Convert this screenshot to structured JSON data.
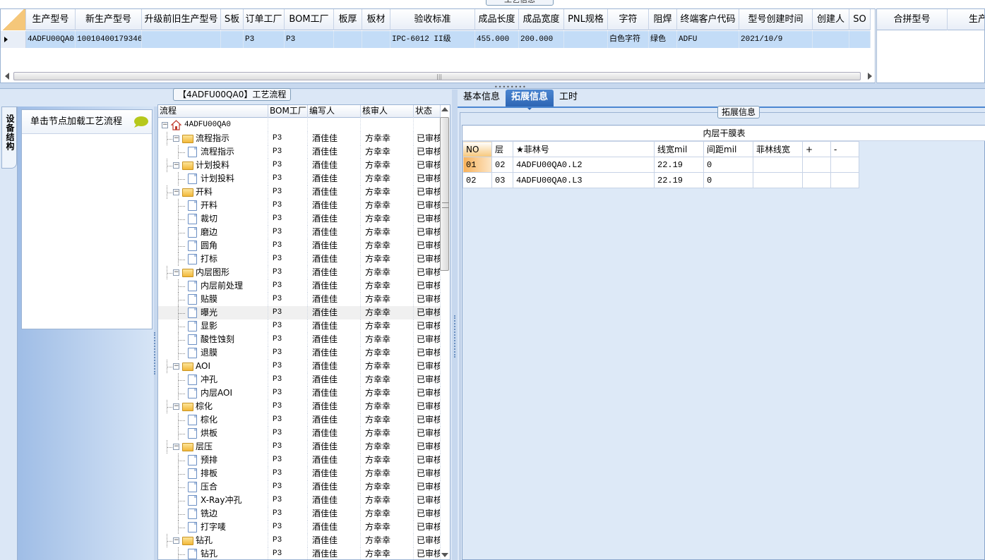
{
  "top": {
    "title": "工艺信息",
    "main_columns": [
      {
        "label": "生产型号",
        "w": 70
      },
      {
        "label": "新生产型号",
        "w": 94
      },
      {
        "label": "升级前旧生产型号",
        "w": 112
      },
      {
        "label": "S板",
        "w": 32
      },
      {
        "label": "订单工厂",
        "w": 58
      },
      {
        "label": "BOM工厂",
        "w": 70
      },
      {
        "label": "板厚",
        "w": 40
      },
      {
        "label": "板材",
        "w": 40
      },
      {
        "label": "验收标准",
        "w": 120
      },
      {
        "label": "成品长度",
        "w": 62
      },
      {
        "label": "成品宽度",
        "w": 64
      },
      {
        "label": "PNL规格",
        "w": 62
      },
      {
        "label": "字符",
        "w": 58
      },
      {
        "label": "阻焊",
        "w": 40
      },
      {
        "label": "终端客户代码",
        "w": 88
      },
      {
        "label": "型号创建时间",
        "w": 104
      },
      {
        "label": "创建人",
        "w": 52
      },
      {
        "label": "SO",
        "w": 30
      }
    ],
    "row": [
      "4ADFU00QA0",
      "10010400179346",
      "",
      "",
      "P3",
      "P3",
      "",
      "",
      "IPC-6012 II级",
      "455.000",
      "200.000",
      "",
      "白色字符",
      "绿色",
      "ADFU",
      "2021/10/9",
      "",
      ""
    ],
    "side_columns": [
      {
        "label": "合拼型号",
        "w": 100
      },
      {
        "label": "生产型",
        "w": 100
      }
    ]
  },
  "left": {
    "legend": "【4ADFU00QA0】工艺流程",
    "side_tab": "设备结构",
    "load_hint": "单击节点加载工艺流程",
    "tree_columns": [
      "流程",
      "BOM工厂",
      "编写人",
      "核审人",
      "状态"
    ],
    "tree": [
      {
        "level": 0,
        "type": "root",
        "name": "4ADFU00QA0",
        "bom": "",
        "writer": "",
        "reviewer": "",
        "status": ""
      },
      {
        "level": 1,
        "type": "folder",
        "name": "流程指示",
        "bom": "P3",
        "writer": "酒佳佳",
        "reviewer": "方幸幸",
        "status": "已审核"
      },
      {
        "level": 2,
        "type": "doc",
        "name": "流程指示",
        "bom": "P3",
        "writer": "酒佳佳",
        "reviewer": "方幸幸",
        "status": "已审核"
      },
      {
        "level": 1,
        "type": "folder",
        "name": "计划投料",
        "bom": "P3",
        "writer": "酒佳佳",
        "reviewer": "方幸幸",
        "status": "已审核"
      },
      {
        "level": 2,
        "type": "doc",
        "name": "计划投料",
        "bom": "P3",
        "writer": "酒佳佳",
        "reviewer": "方幸幸",
        "status": "已审核"
      },
      {
        "level": 1,
        "type": "folder",
        "name": "开料",
        "bom": "P3",
        "writer": "酒佳佳",
        "reviewer": "方幸幸",
        "status": "已审核"
      },
      {
        "level": 2,
        "type": "doc",
        "name": "开料",
        "bom": "P3",
        "writer": "酒佳佳",
        "reviewer": "方幸幸",
        "status": "已审核"
      },
      {
        "level": 2,
        "type": "doc",
        "name": "裁切",
        "bom": "P3",
        "writer": "酒佳佳",
        "reviewer": "方幸幸",
        "status": "已审核"
      },
      {
        "level": 2,
        "type": "doc",
        "name": "磨边",
        "bom": "P3",
        "writer": "酒佳佳",
        "reviewer": "方幸幸",
        "status": "已审核"
      },
      {
        "level": 2,
        "type": "doc",
        "name": "圆角",
        "bom": "P3",
        "writer": "酒佳佳",
        "reviewer": "方幸幸",
        "status": "已审核"
      },
      {
        "level": 2,
        "type": "doc",
        "name": "打标",
        "bom": "P3",
        "writer": "酒佳佳",
        "reviewer": "方幸幸",
        "status": "已审核"
      },
      {
        "level": 1,
        "type": "folder",
        "name": "内层图形",
        "bom": "P3",
        "writer": "酒佳佳",
        "reviewer": "方幸幸",
        "status": "已审核"
      },
      {
        "level": 2,
        "type": "doc",
        "name": "内层前处理",
        "bom": "P3",
        "writer": "酒佳佳",
        "reviewer": "方幸幸",
        "status": "已审核"
      },
      {
        "level": 2,
        "type": "doc",
        "name": "贴膜",
        "bom": "P3",
        "writer": "酒佳佳",
        "reviewer": "方幸幸",
        "status": "已审核"
      },
      {
        "level": 2,
        "type": "doc",
        "name": "曝光",
        "bom": "P3",
        "writer": "酒佳佳",
        "reviewer": "方幸幸",
        "status": "已审核",
        "selected": true
      },
      {
        "level": 2,
        "type": "doc",
        "name": "显影",
        "bom": "P3",
        "writer": "酒佳佳",
        "reviewer": "方幸幸",
        "status": "已审核"
      },
      {
        "level": 2,
        "type": "doc",
        "name": "酸性蚀刻",
        "bom": "P3",
        "writer": "酒佳佳",
        "reviewer": "方幸幸",
        "status": "已审核"
      },
      {
        "level": 2,
        "type": "doc",
        "name": "退膜",
        "bom": "P3",
        "writer": "酒佳佳",
        "reviewer": "方幸幸",
        "status": "已审核"
      },
      {
        "level": 1,
        "type": "folder",
        "name": "AOI",
        "bom": "P3",
        "writer": "酒佳佳",
        "reviewer": "方幸幸",
        "status": "已审核"
      },
      {
        "level": 2,
        "type": "doc",
        "name": "冲孔",
        "bom": "P3",
        "writer": "酒佳佳",
        "reviewer": "方幸幸",
        "status": "已审核"
      },
      {
        "level": 2,
        "type": "doc",
        "name": "内层AOI",
        "bom": "P3",
        "writer": "酒佳佳",
        "reviewer": "方幸幸",
        "status": "已审核"
      },
      {
        "level": 1,
        "type": "folder",
        "name": "棕化",
        "bom": "P3",
        "writer": "酒佳佳",
        "reviewer": "方幸幸",
        "status": "已审核"
      },
      {
        "level": 2,
        "type": "doc",
        "name": "棕化",
        "bom": "P3",
        "writer": "酒佳佳",
        "reviewer": "方幸幸",
        "status": "已审核"
      },
      {
        "level": 2,
        "type": "doc",
        "name": "烘板",
        "bom": "P3",
        "writer": "酒佳佳",
        "reviewer": "方幸幸",
        "status": "已审核"
      },
      {
        "level": 1,
        "type": "folder",
        "name": "层压",
        "bom": "P3",
        "writer": "酒佳佳",
        "reviewer": "方幸幸",
        "status": "已审核"
      },
      {
        "level": 2,
        "type": "doc",
        "name": "预排",
        "bom": "P3",
        "writer": "酒佳佳",
        "reviewer": "方幸幸",
        "status": "已审核"
      },
      {
        "level": 2,
        "type": "doc",
        "name": "排板",
        "bom": "P3",
        "writer": "酒佳佳",
        "reviewer": "方幸幸",
        "status": "已审核"
      },
      {
        "level": 2,
        "type": "doc",
        "name": "压合",
        "bom": "P3",
        "writer": "酒佳佳",
        "reviewer": "方幸幸",
        "status": "已审核"
      },
      {
        "level": 2,
        "type": "doc",
        "name": "X-Ray冲孔",
        "bom": "P3",
        "writer": "酒佳佳",
        "reviewer": "方幸幸",
        "status": "已审核"
      },
      {
        "level": 2,
        "type": "doc",
        "name": "铣边",
        "bom": "P3",
        "writer": "酒佳佳",
        "reviewer": "方幸幸",
        "status": "已审核"
      },
      {
        "level": 2,
        "type": "doc",
        "name": "打字唛",
        "bom": "P3",
        "writer": "酒佳佳",
        "reviewer": "方幸幸",
        "status": "已审核"
      },
      {
        "level": 1,
        "type": "folder",
        "name": "钻孔",
        "bom": "P3",
        "writer": "酒佳佳",
        "reviewer": "方幸幸",
        "status": "已审核"
      },
      {
        "level": 2,
        "type": "doc",
        "name": "钻孔",
        "bom": "P3",
        "writer": "酒佳佳",
        "reviewer": "方幸幸",
        "status": "已审核"
      }
    ]
  },
  "right": {
    "tabs": [
      {
        "label": "基本信息",
        "active": false
      },
      {
        "label": "拓展信息",
        "active": true
      },
      {
        "label": "工时",
        "active": false
      }
    ],
    "legend": "拓展信息",
    "film_title": "内层干膜表",
    "film_columns": [
      "NO",
      "层",
      "★菲林号",
      "线宽mil",
      "间距mil",
      "菲林线宽",
      "+",
      "-"
    ],
    "film_rows": [
      [
        "01",
        "02",
        "4ADFU00QA0.L2",
        "22.19",
        "0",
        "",
        "",
        ""
      ],
      [
        "02",
        "03",
        "4ADFU00QA0.L3",
        "22.19",
        "0",
        "",
        "",
        ""
      ]
    ]
  }
}
